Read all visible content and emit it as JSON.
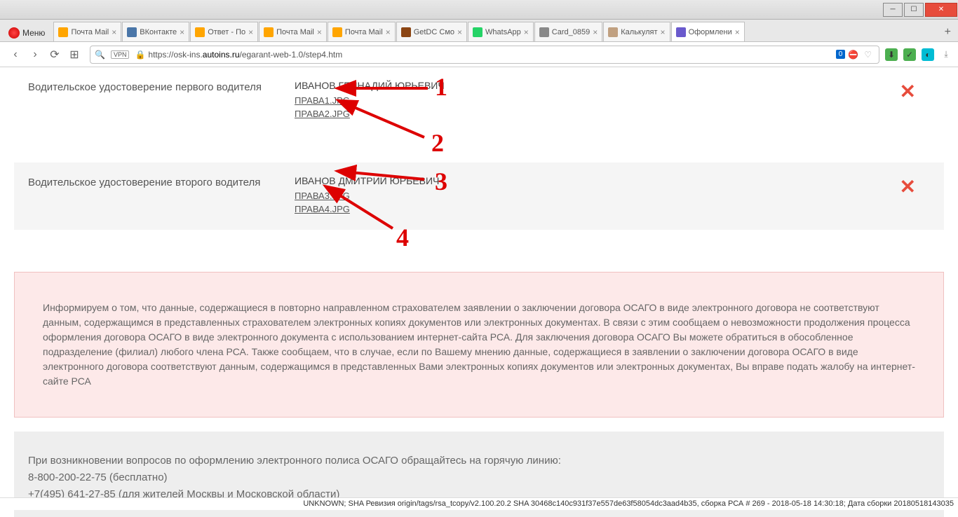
{
  "menu_label": "Меню",
  "tabs": [
    {
      "label": "Почта Mail",
      "icon": "mail"
    },
    {
      "label": "ВКонтакте",
      "icon": "vk"
    },
    {
      "label": "Ответ - По",
      "icon": "mail"
    },
    {
      "label": "Почта Mail",
      "icon": "mail"
    },
    {
      "label": "Почта Mail",
      "icon": "mail"
    },
    {
      "label": "GetDC Смо",
      "icon": "getdc"
    },
    {
      "label": "WhatsApp",
      "icon": "wa"
    },
    {
      "label": "Card_0859",
      "icon": "card"
    },
    {
      "label": "Калькулят",
      "icon": "calc"
    },
    {
      "label": "Оформлени",
      "icon": "of",
      "active": true
    }
  ],
  "url": {
    "prefix": "https://osk-ins.",
    "highlight": "autoins.ru",
    "suffix": "/egarant-web-1.0/step4.htm"
  },
  "addr_badge": "0",
  "driver1": {
    "label": "Водительское удостоверение первого водителя",
    "name": "ИВАНОВ ГЕННАДИЙ ЮРЬЕВИЧ",
    "file1": "ПРАВА1.JPG",
    "file2": "ПРАВА2.JPG"
  },
  "driver2": {
    "label": "Водительское удостоверение второго водителя",
    "name": "ИВАНОВ ДМИТРИЙ ЮРЬЕВИЧ",
    "file1": "ПРАВА3.JPG",
    "file2": "ПРАВА4.JPG"
  },
  "message": "Информируем о том, что данные, содержащиеся в повторно направленном страхователем заявлении о заключении договора ОСАГО в виде электронного договора не соответствуют данным, содержащимся в представленных страхователем электронных копиях документов или электронных документах. В связи с этим сообщаем о невозможности продолжения процесса оформления договора ОСАГО в виде электронного документа с использованием интернет-сайта РСА. Для заключения договора ОСАГО Вы можете обратиться в обособленное подразделение (филиал) любого члена РСА. Также сообщаем, что в случае, если по Вашему мнению данные, содержащиеся в заявлении о заключении договора ОСАГО в виде электронного договора соответствуют данным, содержащимся в представленных Вами электронных копиях документов или электронных документах, Вы вправе подать жалобу на интернет-сайте РСА",
  "footer": {
    "line1": "При возникновении вопросов по оформлению электронного полиса ОСАГО обращайтесь на горячую линию:",
    "line2": "8-800-200-22-75 (бесплатно)",
    "line3": "+7(495) 641-27-85 (для жителей Москвы и Московской области)"
  },
  "status": "UNKNOWN; SHA Ревизия origin/tags/rsa_tcopy/v2.100.20.2 SHA 30468c140c931f37e557de63f58054dc3aad4b35, сборка РСА # 269 - 2018-05-18 14:30:18; Дата сборки 20180518143035",
  "annotations": {
    "a1": "1",
    "a2": "2",
    "a3": "3",
    "a4": "4"
  }
}
